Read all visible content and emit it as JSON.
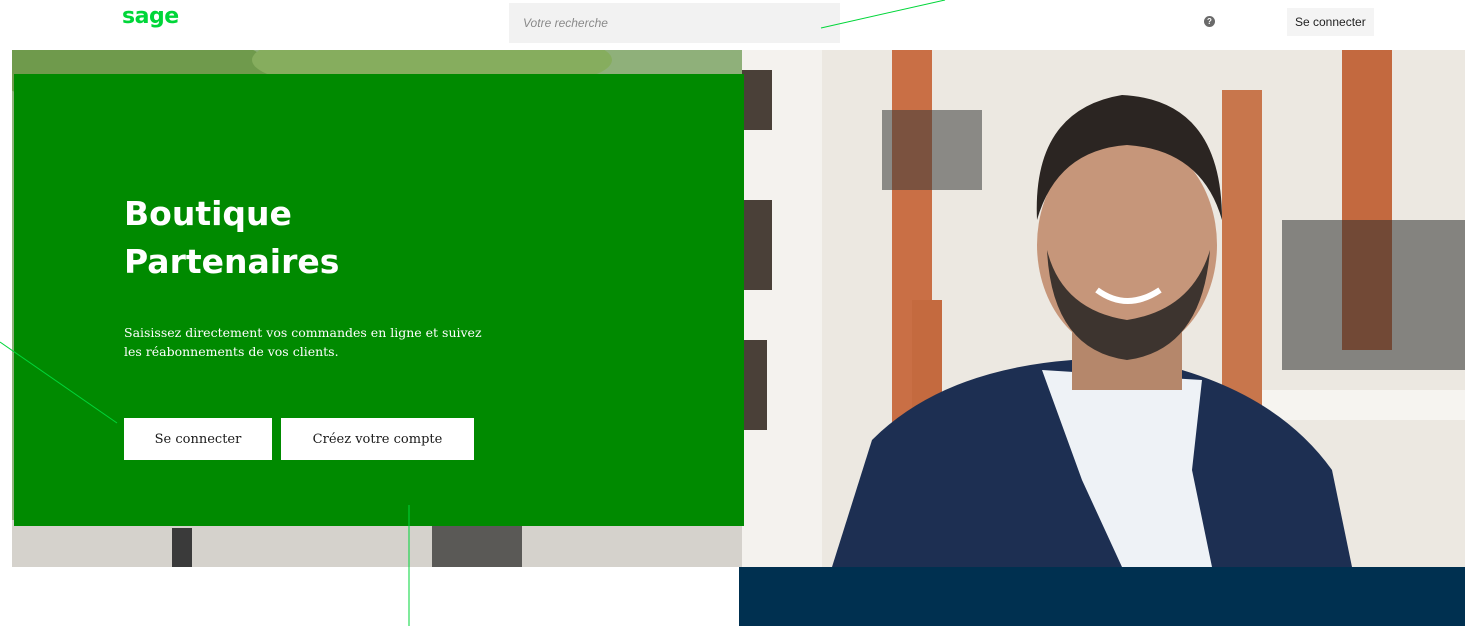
{
  "header": {
    "logo": "sage",
    "search_placeholder": "Votre recherche",
    "help_icon": "help-circle-icon",
    "login_label": "Se connecter"
  },
  "hero": {
    "title_line1": "Boutique",
    "title_line2": "Partenaires",
    "description_line1": "Saisissez directement vos commandes en ligne et suivez",
    "description_line2": "les réabonnements de vos clients.",
    "login_button": "Se connecter",
    "create_button": "Créez votre compte"
  },
  "colors": {
    "brand_green": "#00d639",
    "card_green": "#008a00",
    "navy": "#003050",
    "annotation_line": "#00d639"
  }
}
